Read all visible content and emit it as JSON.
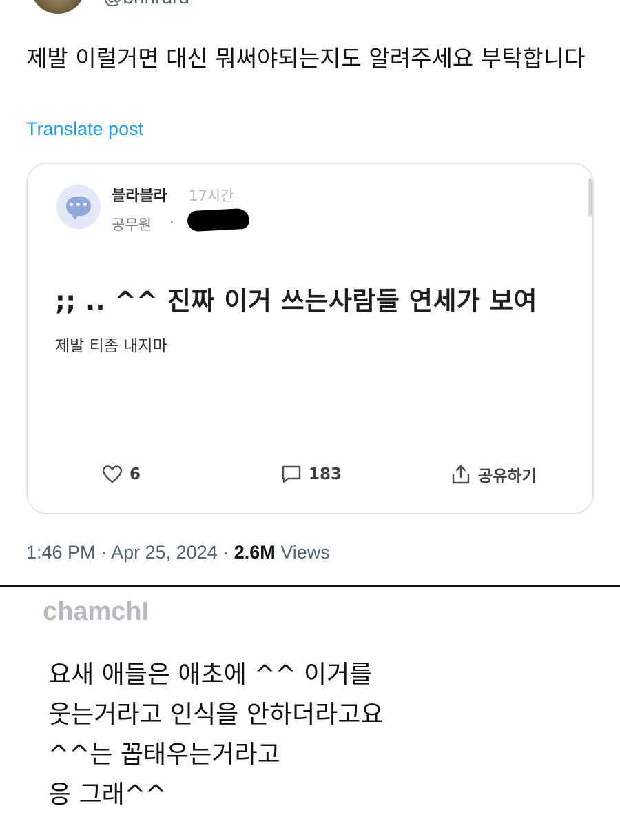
{
  "tweet": {
    "handle": "@bnnrurd",
    "text": "제발 이럴거면 대신 뭐써야되는지도 알려주세요 부탁합니다",
    "translate_label": "Translate post",
    "meta": {
      "time": "1:46 PM",
      "sep1": " · ",
      "date": "Apr 25, 2024",
      "sep2": " · ",
      "views_count": "2.6M",
      "views_label": " Views"
    }
  },
  "card": {
    "author": "블라블라",
    "time_ago": "17시간",
    "job": "공무원",
    "dot": "·",
    "avatar_dots": "•••",
    "title": ";; .. ^^ 진짜 이거 쓰는사람들 연세가 보여",
    "body": "제발 티좀 내지마",
    "actions": {
      "likes": "6",
      "comments": "183",
      "share_label": "공유하기"
    }
  },
  "comment": {
    "username": "chamchI",
    "lines": [
      "요새 애들은 애초에 ^^ 이거를",
      "웃는거라고 인식을 안하더라고요",
      "^^는 꼽태우는거라고",
      "응 그래^^"
    ]
  },
  "colors": {
    "link_blue": "#1d9bf0",
    "muted_gray": "#536471",
    "card_border": "#e1e5e9"
  }
}
